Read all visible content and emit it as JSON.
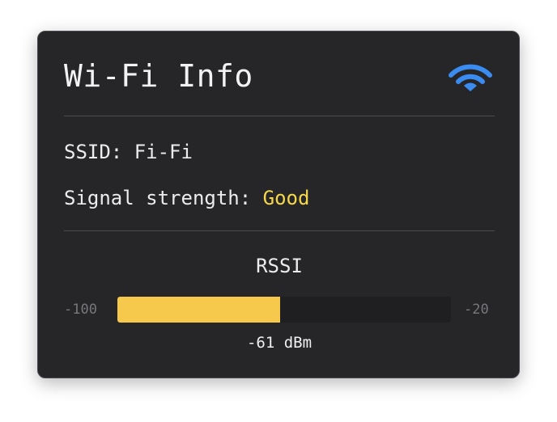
{
  "panel": {
    "title": "Wi-Fi Info",
    "wifi_icon": "wifi-icon",
    "accent_color": "#3b8cf0"
  },
  "info": {
    "ssid_label": "SSID: ",
    "ssid_value": "Fi-Fi",
    "signal_label": "Signal strength: ",
    "signal_value": "Good",
    "signal_value_color": "#f5d84a"
  },
  "rssi": {
    "label": "RSSI",
    "min_label": "-100",
    "max_label": "-20",
    "min": -100,
    "max": -20,
    "value": -61,
    "reading": "-61 dBm",
    "fill_color": "#f6c84b"
  }
}
